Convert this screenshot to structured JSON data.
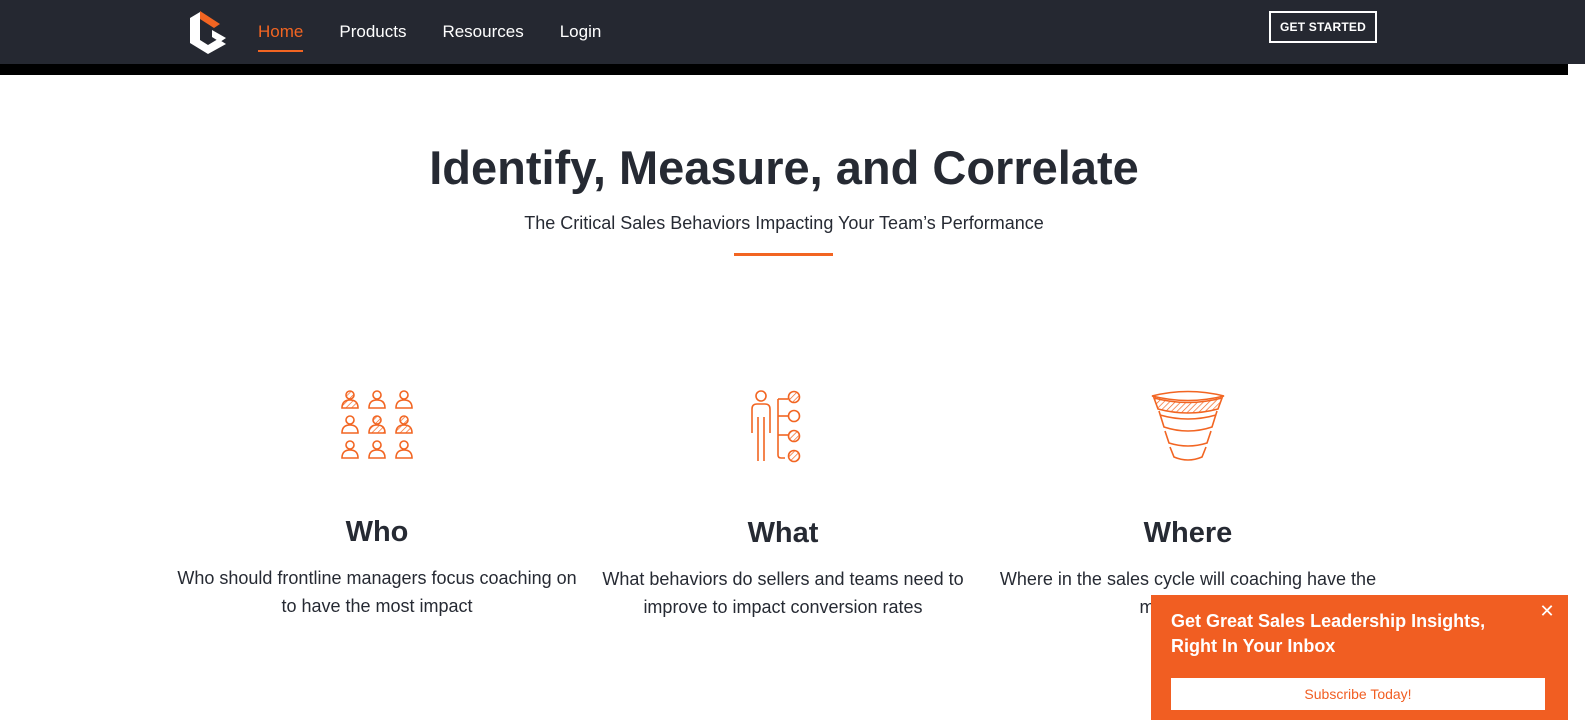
{
  "colors": {
    "nav_bg": "#252831",
    "accent": "#f26522",
    "text": "#262a33",
    "popup_bg": "#f15e22"
  },
  "header": {
    "logo_icon": "brand-logo-icon",
    "nav": [
      {
        "label": "Home",
        "active": true
      },
      {
        "label": "Products",
        "active": false
      },
      {
        "label": "Resources",
        "active": false
      },
      {
        "label": "Login",
        "active": false
      }
    ],
    "cta_label": "GET STARTED"
  },
  "hero": {
    "title": "Identify, Measure, and Correlate",
    "subtitle": "The Critical Sales Behaviors Impacting Your Team’s Performance"
  },
  "features": [
    {
      "icon": "people-grid-icon",
      "title": "Who",
      "text": "Who should frontline managers focus coaching on to have the most impact"
    },
    {
      "icon": "person-checklist-icon",
      "title": "What",
      "text": "What behaviors do sellers and teams need to improve to impact conversion rates"
    },
    {
      "icon": "funnel-icon",
      "title": "Where",
      "text": "Where in the sales cycle will coaching have the most impact"
    }
  ],
  "popup": {
    "title": "Get Great Sales Leadership Insights, Right In Your Inbox",
    "close_icon": "close-icon",
    "button_label": "Subscribe Today!"
  }
}
